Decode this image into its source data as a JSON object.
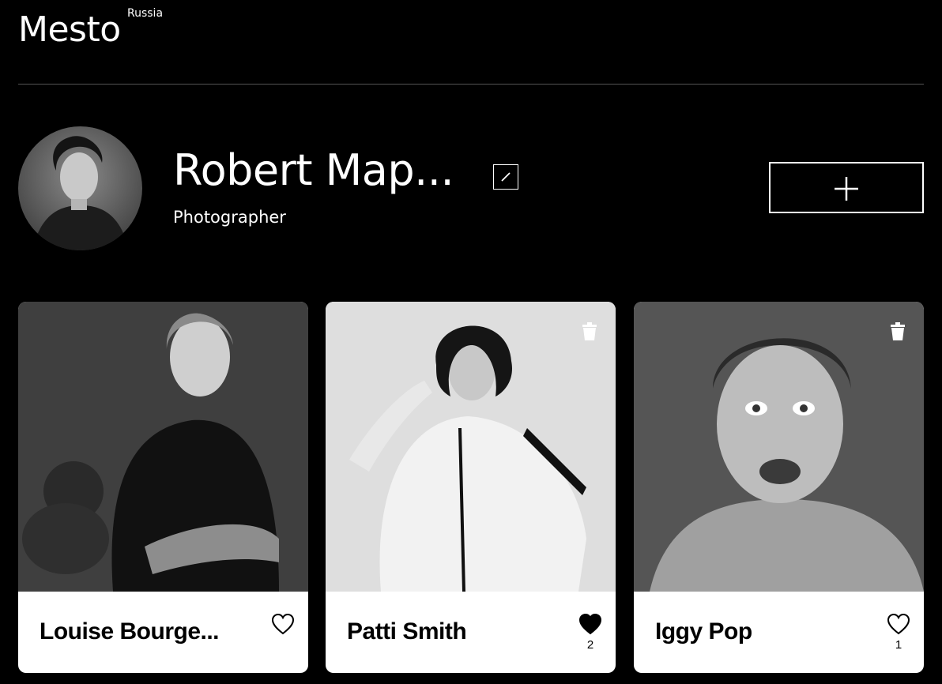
{
  "header": {
    "logo_text": "Mesto",
    "logo_sup": "Russia"
  },
  "profile": {
    "name": "Robert Map...",
    "about": "Photographer"
  },
  "cards": [
    {
      "title": "Louise Bourge...",
      "liked": false,
      "like_count": "",
      "deletable": false
    },
    {
      "title": "Patti Smith",
      "liked": true,
      "like_count": "2",
      "deletable": true
    },
    {
      "title": "Iggy Pop",
      "liked": false,
      "like_count": "1",
      "deletable": true
    }
  ],
  "icons": {
    "edit": "pencil-icon",
    "add": "plus-icon",
    "like": "heart-icon",
    "delete": "trash-icon"
  }
}
